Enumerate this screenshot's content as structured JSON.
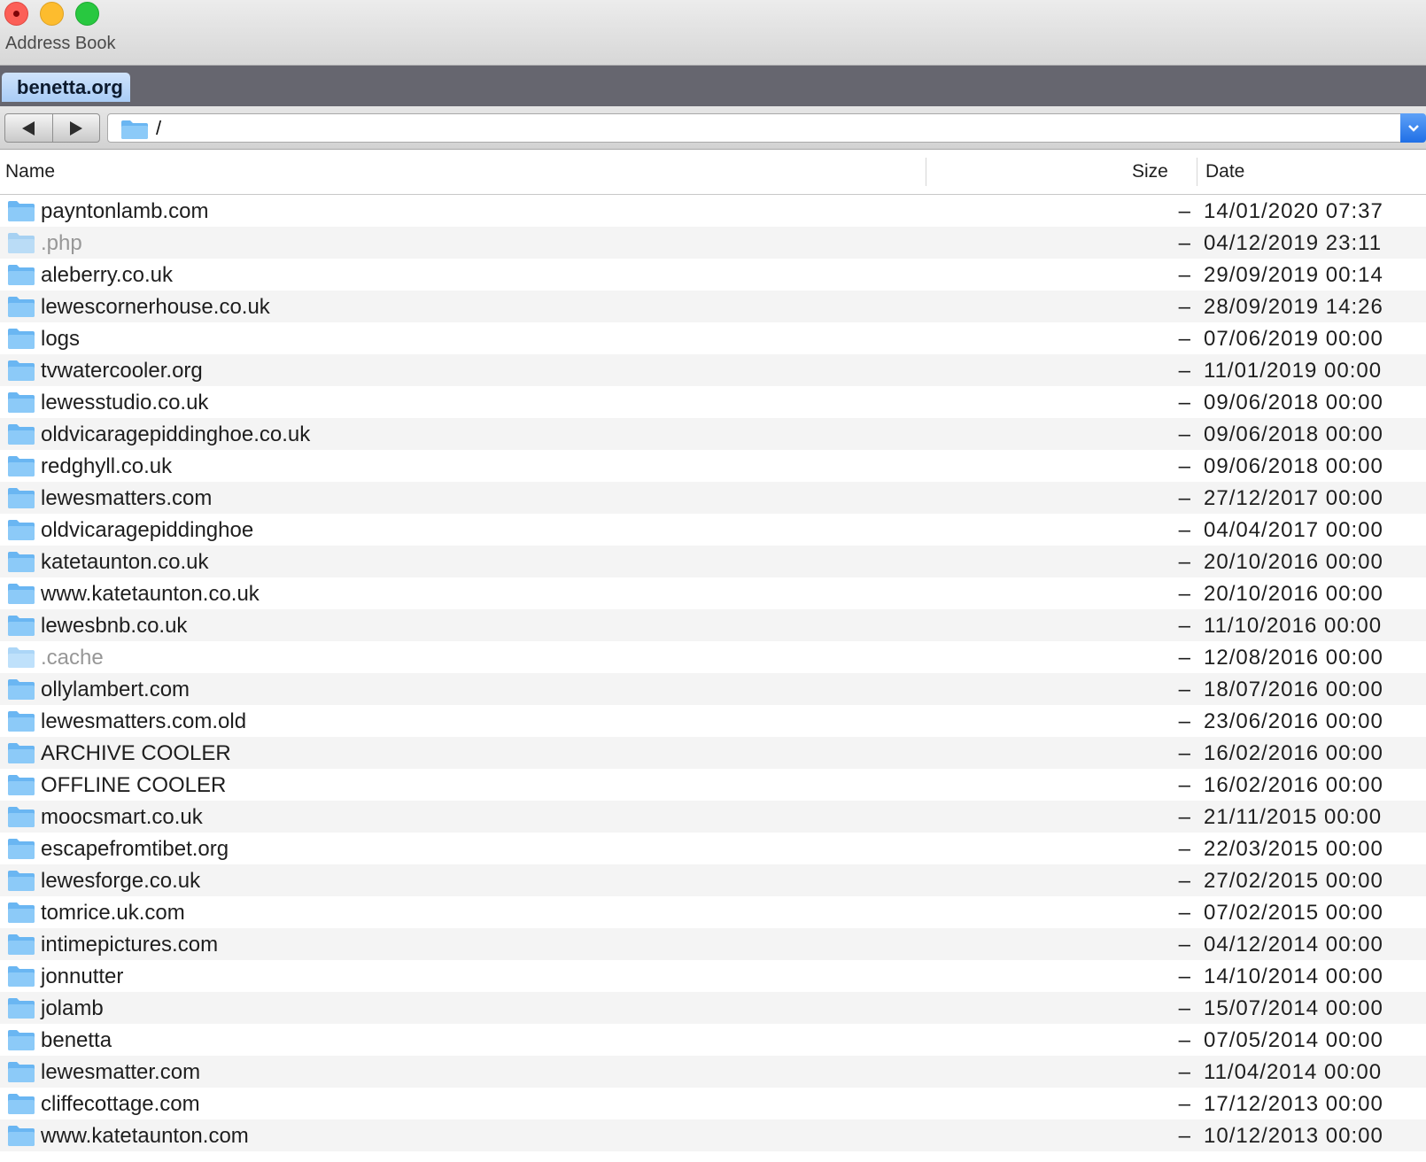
{
  "window": {
    "title": "Address Book"
  },
  "tabs": [
    {
      "label": "benetta.org",
      "active": true
    }
  ],
  "nav": {
    "back_icon": "back-arrow-icon",
    "forward_icon": "forward-arrow-icon",
    "path": "/"
  },
  "columns": {
    "name": "Name",
    "size": "Size",
    "date": "Date"
  },
  "colors": {
    "folder": "#6ab6f2",
    "tab_active": "#b6d4f8",
    "tabstrip": "#66666f",
    "dropdown": "#2f7ef0"
  },
  "files": [
    {
      "name": "payntonlamb.com",
      "size": "–",
      "date": "14/01/2020 07:37",
      "hidden": false
    },
    {
      "name": ".php",
      "size": "–",
      "date": "04/12/2019 23:11",
      "hidden": true
    },
    {
      "name": "aleberry.co.uk",
      "size": "–",
      "date": "29/09/2019 00:14",
      "hidden": false
    },
    {
      "name": "lewescornerhouse.co.uk",
      "size": "–",
      "date": "28/09/2019 14:26",
      "hidden": false
    },
    {
      "name": "logs",
      "size": "–",
      "date": "07/06/2019 00:00",
      "hidden": false
    },
    {
      "name": "tvwatercooler.org",
      "size": "–",
      "date": "11/01/2019 00:00",
      "hidden": false
    },
    {
      "name": "lewesstudio.co.uk",
      "size": "–",
      "date": "09/06/2018 00:00",
      "hidden": false
    },
    {
      "name": "oldvicaragepiddinghoe.co.uk",
      "size": "–",
      "date": "09/06/2018 00:00",
      "hidden": false
    },
    {
      "name": "redghyll.co.uk",
      "size": "–",
      "date": "09/06/2018 00:00",
      "hidden": false
    },
    {
      "name": "lewesmatters.com",
      "size": "–",
      "date": "27/12/2017 00:00",
      "hidden": false
    },
    {
      "name": "oldvicaragepiddinghoe",
      "size": "–",
      "date": "04/04/2017 00:00",
      "hidden": false
    },
    {
      "name": "katetaunton.co.uk",
      "size": "–",
      "date": "20/10/2016 00:00",
      "hidden": false
    },
    {
      "name": "www.katetaunton.co.uk",
      "size": "–",
      "date": "20/10/2016 00:00",
      "hidden": false
    },
    {
      "name": "lewesbnb.co.uk",
      "size": "–",
      "date": "11/10/2016 00:00",
      "hidden": false
    },
    {
      "name": ".cache",
      "size": "–",
      "date": "12/08/2016 00:00",
      "hidden": true
    },
    {
      "name": "ollylambert.com",
      "size": "–",
      "date": "18/07/2016 00:00",
      "hidden": false
    },
    {
      "name": "lewesmatters.com.old",
      "size": "–",
      "date": "23/06/2016 00:00",
      "hidden": false
    },
    {
      "name": "ARCHIVE COOLER",
      "size": "–",
      "date": "16/02/2016 00:00",
      "hidden": false
    },
    {
      "name": "OFFLINE COOLER",
      "size": "–",
      "date": "16/02/2016 00:00",
      "hidden": false
    },
    {
      "name": "moocsmart.co.uk",
      "size": "–",
      "date": "21/11/2015 00:00",
      "hidden": false
    },
    {
      "name": "escapefromtibet.org",
      "size": "–",
      "date": "22/03/2015 00:00",
      "hidden": false
    },
    {
      "name": "lewesforge.co.uk",
      "size": "–",
      "date": "27/02/2015 00:00",
      "hidden": false
    },
    {
      "name": "tomrice.uk.com",
      "size": "–",
      "date": "07/02/2015 00:00",
      "hidden": false
    },
    {
      "name": "intimepictures.com",
      "size": "–",
      "date": "04/12/2014 00:00",
      "hidden": false
    },
    {
      "name": "jonnutter",
      "size": "–",
      "date": "14/10/2014 00:00",
      "hidden": false
    },
    {
      "name": "jolamb",
      "size": "–",
      "date": "15/07/2014 00:00",
      "hidden": false
    },
    {
      "name": "benetta",
      "size": "–",
      "date": "07/05/2014 00:00",
      "hidden": false
    },
    {
      "name": "lewesmatter.com",
      "size": "–",
      "date": "11/04/2014 00:00",
      "hidden": false
    },
    {
      "name": "cliffecottage.com",
      "size": "–",
      "date": "17/12/2013 00:00",
      "hidden": false
    },
    {
      "name": "www.katetaunton.com",
      "size": "–",
      "date": "10/12/2013 00:00",
      "hidden": false
    }
  ]
}
